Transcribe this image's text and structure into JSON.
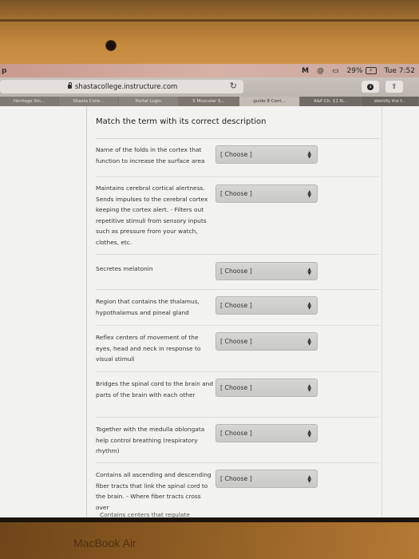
{
  "menubar": {
    "app_fragment": "p",
    "battery_percent": "29%",
    "clock": "Tue 7:52"
  },
  "toolbar": {
    "address": "shastacollege.instructure.com",
    "reload_glyph": "↻",
    "share_glyph": "⇪"
  },
  "tabs": [
    {
      "label": "Heritage Sin...",
      "active": false
    },
    {
      "label": "Shasta Colle...",
      "active": false
    },
    {
      "label": "Portal Login",
      "active": false
    },
    {
      "label": "5 Muscular S...",
      "active": false
    },
    {
      "label": "guide 8 Cent...",
      "active": true
    },
    {
      "label": "A&P Ch. 11 N...",
      "active": false
    },
    {
      "label": "identify the f...",
      "active": false
    }
  ],
  "question": {
    "title": "Match the term with its correct description",
    "items": [
      {
        "term": "Name of the folds in the cortex that function to increase the surface area",
        "selected": "[ Choose ]"
      },
      {
        "term": "Maintains cerebral cortical alertness. Sends impulses to the cerebral cortex keeping the cortex alert. - Filters out repetitive stimuli from sensory inputs such as pressure from your watch, clothes, etc.",
        "selected": "[ Choose ]"
      },
      {
        "term": "Secretes melatonin",
        "selected": "[ Choose ]"
      },
      {
        "term": "Region that contains the thalamus, hypothalamus and pineal gland",
        "selected": "[ Choose ]"
      },
      {
        "term": "Reflex centers of movement of the eyes, head and neck in response to visual stimuli",
        "selected": "[ Choose ]"
      },
      {
        "term": "Bridges the spinal cord to the brain and parts of the brain with each other",
        "selected": "[ Choose ]"
      },
      {
        "term": "Together with the medulla oblongata help control breathing (respiratory rhythm)",
        "selected": "[ Choose ]"
      },
      {
        "term": "Contains all ascending and descending fiber tracts that link the spinal cord to the brain. - Where fiber tracts cross over",
        "selected": "[ Choose ]"
      }
    ],
    "cutoff_term": "Contains centers that regulate"
  },
  "device": {
    "brand": "MacBook Air"
  }
}
